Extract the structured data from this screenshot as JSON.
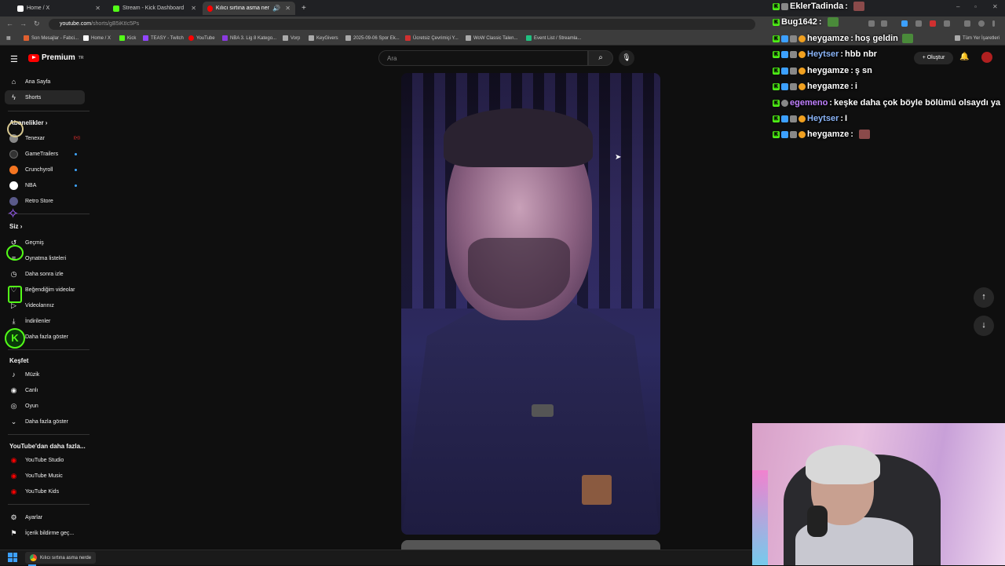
{
  "browser": {
    "tabs": [
      {
        "label": "Home / X",
        "icon": "x-logo",
        "color": "#ffffff"
      },
      {
        "label": "Stream - Kick Dashboard",
        "icon": "kick-logo",
        "color": "#53fc18"
      },
      {
        "label": "Kılıcı sırtına asma nerden g…",
        "icon": "youtube-logo",
        "color": "#ff0000",
        "active": true
      }
    ],
    "new_tab": "+",
    "url_host": "youtube.com",
    "url_path": "/shorts/gB5iKtIc5Ps",
    "bookmarks": [
      {
        "label": "Son Mesajlar - Fabci...",
        "color": "#e06030"
      },
      {
        "label": "Home / X",
        "color": "#ffffff"
      },
      {
        "label": "Kick",
        "color": "#53fc18"
      },
      {
        "label": "TEASY - Twitch",
        "color": "#9146ff"
      },
      {
        "label": "YouTube",
        "color": "#ff0000"
      },
      {
        "label": "NBA 3. Lig 8 Katego...",
        "color": "#8a3adf"
      },
      {
        "label": "Vorp",
        "color": "#aaaaaa"
      },
      {
        "label": "KeyGivers",
        "color": "#aaaaaa"
      },
      {
        "label": "2025-09-06 Spor Ek...",
        "color": "#aaaaaa"
      },
      {
        "label": "Ücretsiz Çevrimiçi Y...",
        "color": "#d03030"
      },
      {
        "label": "WoW Classic Talen...",
        "color": "#aaaaaa"
      },
      {
        "label": "Event List / Streamla...",
        "color": "#20c080"
      }
    ],
    "all_bookmarks": "Tüm Yer İşaretleri"
  },
  "youtube": {
    "logo_text": "Premium",
    "logo_sup": "TR",
    "search_placeholder": "Ara",
    "create_label": "Oluştur",
    "sidebar": {
      "main": [
        {
          "label": "Ana Sayfa",
          "icon": "home-icon",
          "glyph": "⌂"
        },
        {
          "label": "Shorts",
          "icon": "shorts-icon",
          "glyph": "ϟ",
          "active": true
        }
      ],
      "subs_header": "Abonelikler",
      "subs": [
        {
          "label": "Tenexar",
          "color": "#888888",
          "badge": true
        },
        {
          "label": "GameTrailers",
          "color": "#333333",
          "dot": true
        },
        {
          "label": "Crunchyroll",
          "color": "#f47521",
          "dot": true
        },
        {
          "label": "NBA",
          "color": "#ffffff",
          "dot": true
        },
        {
          "label": "Retro Store",
          "color": "#5a5a8a"
        }
      ],
      "you_header": "Siz",
      "you": [
        {
          "label": "Geçmiş",
          "icon": "history-icon",
          "glyph": "↺"
        },
        {
          "label": "Oynatma listeleri",
          "icon": "playlist-icon",
          "glyph": "≡"
        },
        {
          "label": "Daha sonra izle",
          "icon": "clock-icon",
          "glyph": "◷"
        },
        {
          "label": "Beğendiğim videolar",
          "icon": "like-icon",
          "glyph": "♡"
        },
        {
          "label": "Videolarınız",
          "icon": "video-icon",
          "glyph": "▷"
        },
        {
          "label": "İndirilenler",
          "icon": "download-icon",
          "glyph": "⤓"
        },
        {
          "label": "Daha fazla göster",
          "icon": "chevron-down-icon",
          "glyph": "⌄"
        }
      ],
      "explore_header": "Keşfet",
      "explore": [
        {
          "label": "Müzik",
          "icon": "music-icon",
          "glyph": "♪"
        },
        {
          "label": "Canlı",
          "icon": "live-icon",
          "glyph": "◉"
        },
        {
          "label": "Oyun",
          "icon": "gaming-icon",
          "glyph": "◎"
        },
        {
          "label": "Daha fazla göster",
          "icon": "chevron-down-icon",
          "glyph": "⌄"
        }
      ],
      "more_header": "YouTube'dan daha fazla...",
      "more": [
        {
          "label": "YouTube Studio",
          "color": "#ff0000"
        },
        {
          "label": "YouTube Music",
          "color": "#ff0000"
        },
        {
          "label": "YouTube Kids",
          "color": "#ff0000"
        }
      ],
      "settings": [
        {
          "label": "Ayarlar",
          "icon": "gear-icon",
          "glyph": "⚙"
        },
        {
          "label": "İçerik bildirme geç...",
          "icon": "flag-icon",
          "glyph": "⚑"
        }
      ]
    }
  },
  "chat": [
    {
      "user": "EklerTadinda",
      "user_color": "#ffffff",
      "sep": " :",
      "msg": "",
      "emote": true,
      "badges": [
        "#53fc18",
        "#888888"
      ]
    },
    {
      "user": "Bug1642",
      "user_color": "#ffffff",
      "sep": " :",
      "msg": "",
      "emote": true,
      "emote_green": true,
      "badges": [
        "#53fc18"
      ]
    },
    {
      "user": "heygamze",
      "user_color": "#ffffff",
      "sep": " :",
      "msg": " hoş geldin",
      "emote": true,
      "emote_green": true,
      "badges": [
        "#53fc18",
        "#3ca0ff",
        "#888888",
        "#f0a020"
      ]
    },
    {
      "user": "Heytser",
      "user_color": "#8ab4f8",
      "sep": " :",
      "msg": " hbb nbr",
      "badges": [
        "#53fc18",
        "#3ca0ff",
        "#888888",
        "#f0a020"
      ]
    },
    {
      "user": "heygamze",
      "user_color": "#ffffff",
      "sep": " :",
      "msg": " ş sn",
      "badges": [
        "#53fc18",
        "#3ca0ff",
        "#888888",
        "#f0a020"
      ]
    },
    {
      "user": "heygamze",
      "user_color": "#ffffff",
      "sep": " :",
      "msg": " i",
      "badges": [
        "#53fc18",
        "#3ca0ff",
        "#888888",
        "#f0a020"
      ]
    },
    {
      "user": "egemeno",
      "user_color": "#c080ff",
      "sep": " :",
      "msg": " keşke daha çok böyle bölümü olsaydı ya",
      "badges": [
        "#53fc18",
        "#888888"
      ]
    },
    {
      "user": "Heytser",
      "user_color": "#8ab4f8",
      "sep": " :",
      "msg": " I",
      "badges": [
        "#53fc18",
        "#3ca0ff",
        "#888888",
        "#f0a020"
      ]
    },
    {
      "user": "heygamze",
      "user_color": "#ffffff",
      "sep": " :",
      "msg": "",
      "emote": true,
      "badges": [
        "#53fc18",
        "#3ca0ff",
        "#888888",
        "#f0a020"
      ]
    }
  ],
  "taskbar": {
    "app_label": "Kılıcı sırtına asma nerde"
  },
  "colors": {
    "accent_red": "#ff0000",
    "kick_green": "#53fc18",
    "bg": "#0f0f0f"
  }
}
